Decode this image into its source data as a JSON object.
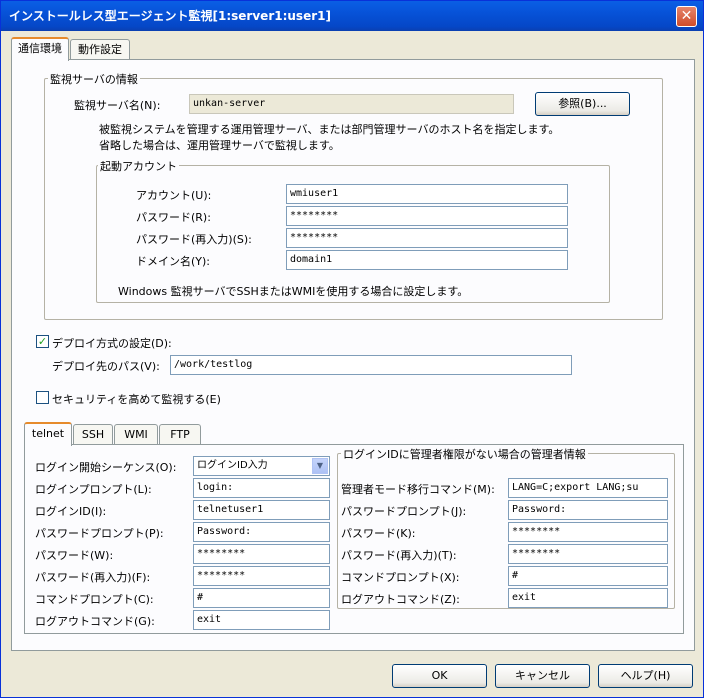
{
  "window": {
    "title": "インストールレス型エージェント監視[1:server1:user1]",
    "close_glyph": "✕"
  },
  "main_tabs": [
    "通信環境",
    "動作設定"
  ],
  "monitor_server": {
    "group_title": "監視サーバの情報",
    "name_label": "監視サーバ名(N):",
    "name_value": "unkan-server",
    "browse_button": "参照(B)...",
    "desc_line1": "被監視システムを管理する運用管理サーバ、または部門管理サーバのホスト名を指定します。",
    "desc_line2": "省略した場合は、運用管理サーバで監視します。"
  },
  "startup_account": {
    "group_title": "起動アカウント",
    "account_label": "アカウント(U):",
    "account_value": "wmiuser1",
    "password_label": "パスワード(R):",
    "password_value": "********",
    "password_confirm_label": "パスワード(再入力)(S):",
    "password_confirm_value": "********",
    "domain_label": "ドメイン名(Y):",
    "domain_value": "domain1",
    "note": "Windows 監視サーバでSSHまたはWMIを使用する場合に設定します。"
  },
  "deploy": {
    "checkbox_label": "デプロイ方式の設定(D):",
    "checked": true,
    "check_glyph": "✓",
    "path_label": "デプロイ先のパス(V):",
    "path_value": "/work/testlog"
  },
  "security": {
    "checkbox_label": "セキュリティを高めて監視する(E)",
    "checked": false
  },
  "protocol_tabs": [
    "telnet",
    "SSH",
    "WMI",
    "FTP"
  ],
  "telnet": {
    "login_sequence_label": "ログイン開始シーケンス(O):",
    "login_sequence_value": "ログインID入力",
    "dropdown_glyph": "▼",
    "login_prompt_label": "ログインプロンプト(L):",
    "login_prompt_value": "login:",
    "login_id_label": "ログインID(I):",
    "login_id_value": "telnetuser1",
    "password_prompt_label": "パスワードプロンプト(P):",
    "password_prompt_value": "Password:",
    "password_label": "パスワード(W):",
    "password_value": "********",
    "password_confirm_label": "パスワード(再入力)(F):",
    "password_confirm_value": "********",
    "command_prompt_label": "コマンドプロンプト(C):",
    "command_prompt_value": "#",
    "logout_label": "ログアウトコマンド(G):",
    "logout_value": "exit"
  },
  "admin_info": {
    "group_title": "ログインIDに管理者権限がない場合の管理者情報",
    "admin_mode_label": "管理者モード移行コマンド(M):",
    "admin_mode_value": "LANG=C;export LANG;su",
    "password_prompt_label": "パスワードプロンプト(J):",
    "password_prompt_value": "Password:",
    "password_label": "パスワード(K):",
    "password_value": "********",
    "password_confirm_label": "パスワード(再入力)(T):",
    "password_confirm_value": "********",
    "command_prompt_label": "コマンドプロンプト(X):",
    "command_prompt_value": "#",
    "logout_label": "ログアウトコマンド(Z):",
    "logout_value": "exit"
  },
  "buttons": {
    "ok": "OK",
    "cancel": "キャンセル",
    "help": "ヘルプ(H)"
  }
}
